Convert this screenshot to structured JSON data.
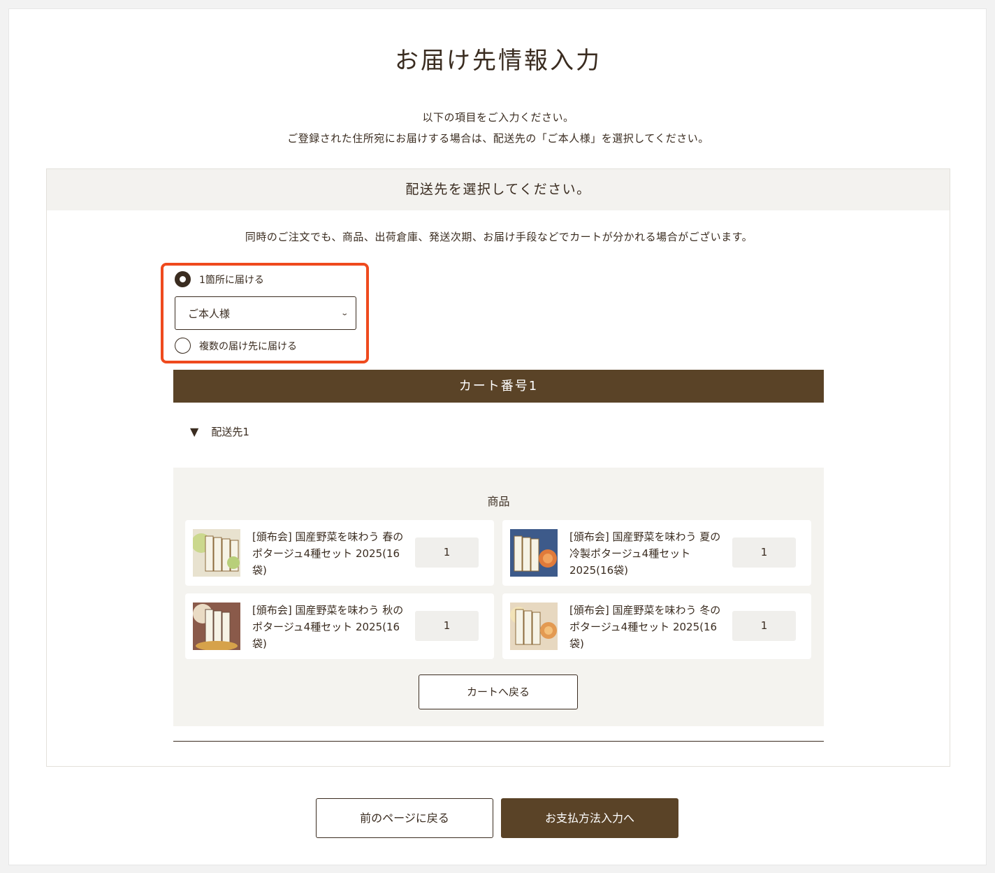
{
  "page": {
    "title": "お届け先情報入力",
    "intro_line1": "以下の項目をご入力ください。",
    "intro_line2": "ご登録された住所宛にお届けする場合は、配送先の「ご本人様」を選択してください。"
  },
  "panel": {
    "heading": "配送先を選択してください。",
    "note": "同時のご注文でも、商品、出荷倉庫、発送次期、お届け手段などでカートが分かれる場合がございます。",
    "option_single": "1箇所に届ける",
    "option_single_selected": true,
    "recipient_select_value": "ご本人様",
    "option_multiple": "複数の届け先に届ける",
    "highlight_color": "#ef4a1e"
  },
  "cart": {
    "header": "カート番号1",
    "destination_toggle": "配送先1",
    "goods_title": "商品",
    "items": [
      {
        "name": "[頒布会] 国産野菜を味わう 春のポタージュ4種セット 2025(16袋)",
        "qty": "1",
        "thumb_color": "#c9d98a"
      },
      {
        "name": "[頒布会] 国産野菜を味わう 夏の冷製ポタージュ4種セット 2025(16袋)",
        "qty": "1",
        "thumb_color": "#e07a3a"
      },
      {
        "name": "[頒布会] 国産野菜を味わう 秋のポタージュ4種セット 2025(16袋)",
        "qty": "1",
        "thumb_color": "#d9c3a0"
      },
      {
        "name": "[頒布会] 国産野菜を味わう 冬のポタージュ4種セット 2025(16袋)",
        "qty": "1",
        "thumb_color": "#e39a52"
      }
    ],
    "back_to_cart": "カートへ戻る"
  },
  "footer": {
    "prev_label": "前のページに戻る",
    "next_label": "お支払方法入力へ"
  },
  "colors": {
    "brand_brown": "#5a4327",
    "text": "#3a2c20"
  }
}
